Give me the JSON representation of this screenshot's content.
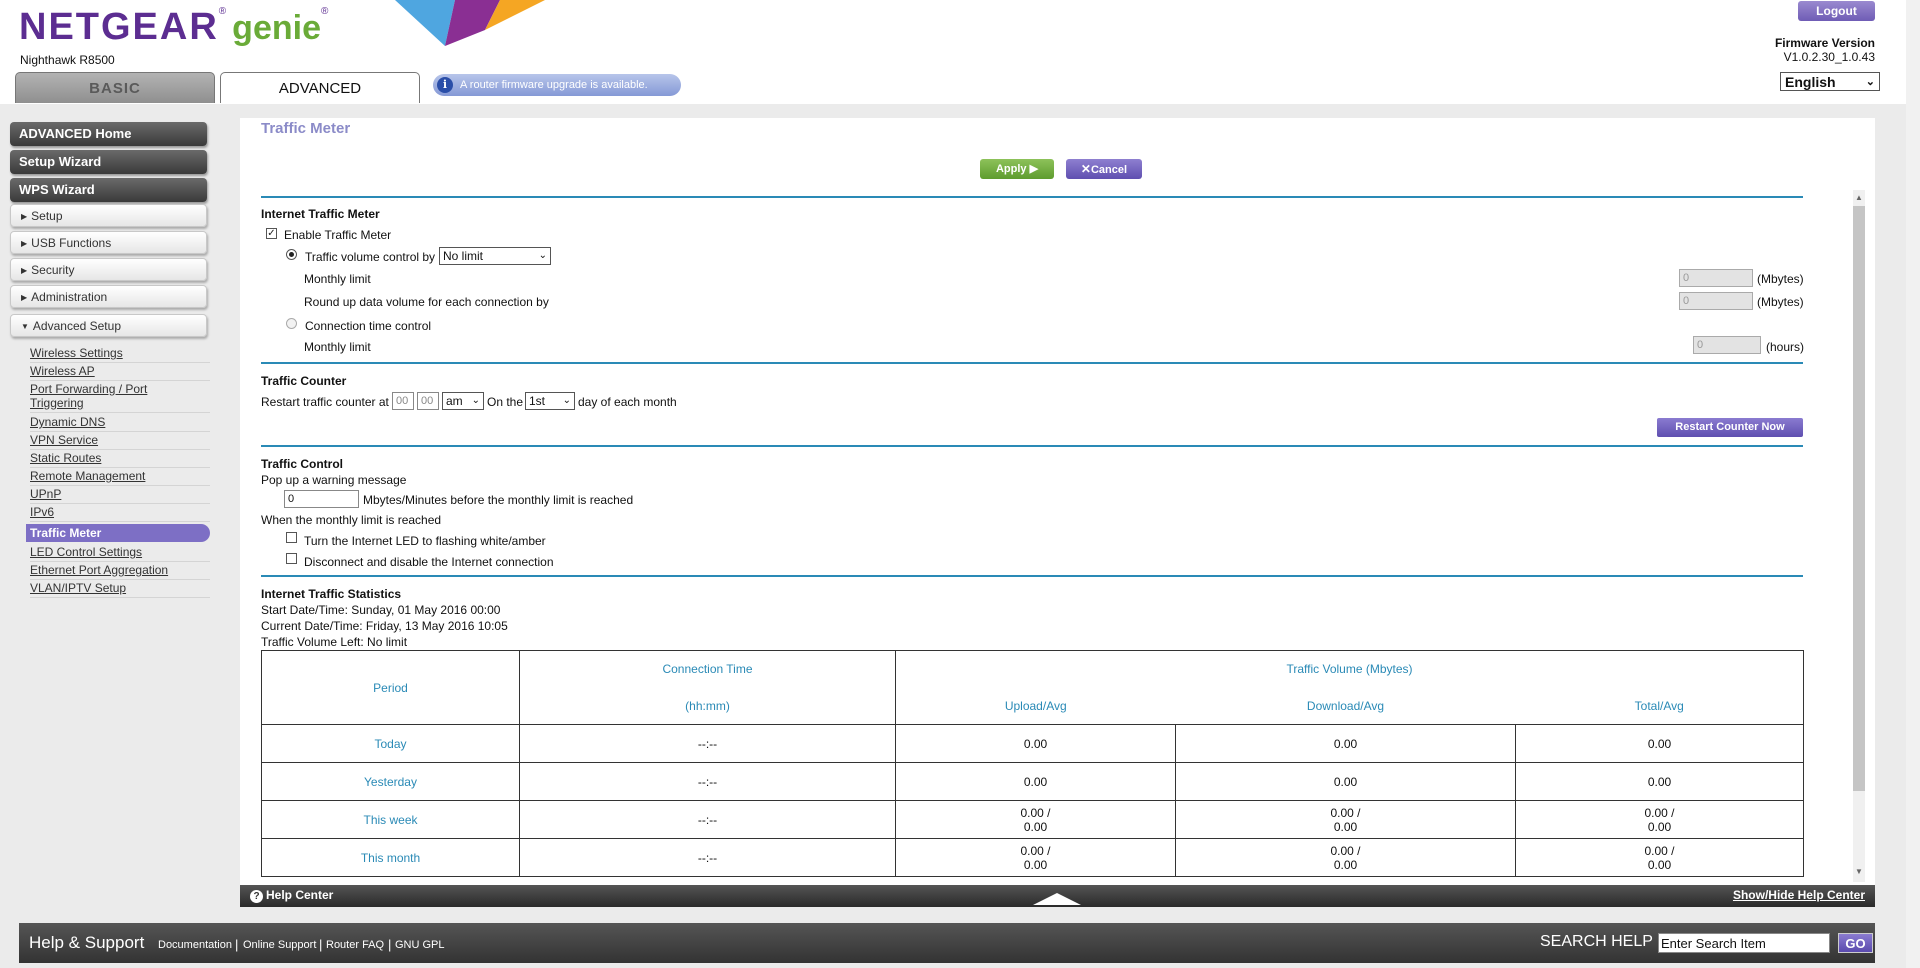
{
  "header": {
    "brand_netgear": "NETGEAR",
    "brand_genie": "genie",
    "brand_reg": "®",
    "model": "Nighthawk R8500",
    "tabs": {
      "basic": "BASIC",
      "advanced": "ADVANCED"
    },
    "firmware_notice": "A router firmware upgrade is available.",
    "logout": "Logout",
    "firmware_label": "Firmware Version",
    "firmware_value": "V1.0.2.30_1.0.43",
    "language": "English"
  },
  "sidebar": {
    "buttons": [
      "ADVANCED Home",
      "Setup Wizard",
      "WPS Wizard"
    ],
    "menus": [
      "Setup",
      "USB Functions",
      "Security",
      "Administration",
      "Advanced Setup"
    ],
    "sub_items": [
      "Wireless Settings",
      "Wireless AP",
      "Port Forwarding / Port",
      "Triggering",
      "Dynamic DNS",
      "VPN Service",
      "Static Routes",
      "Remote Management",
      "UPnP",
      "IPv6",
      "Traffic Meter",
      "LED Control Settings",
      "Ethernet Port Aggregation",
      "VLAN/IPTV Setup"
    ]
  },
  "page": {
    "title": "Traffic Meter",
    "apply": "Apply ▶",
    "cancel": "Cancel",
    "internet_traffic_meter": {
      "title": "Internet Traffic Meter",
      "enable": "Enable Traffic Meter",
      "volume_control": "Traffic volume control by",
      "volume_control_value": "No limit",
      "monthly_limit": "Monthly limit",
      "monthly_limit_value": "0",
      "monthly_limit_unit": "(Mbytes)",
      "round_up": "Round up data volume for each connection by",
      "round_up_value": "0",
      "round_up_unit": "(Mbytes)",
      "time_control": "Connection time control",
      "time_monthly_limit": "Monthly limit",
      "time_monthly_value": "0",
      "time_unit": "(hours)"
    },
    "traffic_counter": {
      "title": "Traffic Counter",
      "restart_at": "Restart traffic counter at",
      "hour": "00",
      "minute": "00",
      "ampm": "am",
      "on_the": "On the",
      "day": "1st",
      "day_suffix": "day of each month",
      "restart_now": "Restart Counter Now"
    },
    "traffic_control": {
      "title": "Traffic Control",
      "popup": "Pop up a warning message",
      "popup_value": "0",
      "popup_suffix": "Mbytes/Minutes before the monthly limit is reached",
      "when_reached": "When the monthly limit is reached",
      "led_flash": "Turn the Internet LED to flashing white/amber",
      "disconnect": "Disconnect and disable the Internet connection"
    },
    "statistics": {
      "title": "Internet Traffic Statistics",
      "start": "Start Date/Time: Sunday, 01 May 2016 00:00",
      "current": "Current Date/Time: Friday, 13 May 2016 10:05",
      "volume_left": "Traffic Volume Left: No limit",
      "headers": {
        "period": "Period",
        "connection_time": "Connection Time",
        "hhmm": "(hh:mm)",
        "traffic_volume": "Traffic Volume (Mbytes)",
        "upload": "Upload/Avg",
        "download": "Download/Avg",
        "total": "Total/Avg"
      },
      "rows": [
        {
          "period": "Today",
          "time": "--:--",
          "upload": "0.00",
          "download": "0.00",
          "total": "0.00"
        },
        {
          "period": "Yesterday",
          "time": "--:--",
          "upload": "0.00",
          "download": "0.00",
          "total": "0.00"
        },
        {
          "period": "This week",
          "time": "--:--",
          "upload": "0.00 /",
          "upload2": "0.00",
          "download": "0.00 /",
          "download2": "0.00",
          "total": "0.00 /",
          "total2": "0.00"
        },
        {
          "period": "This month",
          "time": "--:--",
          "upload": "0.00 /",
          "upload2": "0.00",
          "download": "0.00 /",
          "download2": "0.00",
          "total": "0.00 /",
          "total2": "0.00"
        }
      ]
    }
  },
  "help_bar": {
    "help_center": "Help Center",
    "toggle": "Show/Hide Help Center"
  },
  "footer": {
    "title": "Help & Support",
    "links": [
      "Documentation",
      "Online Support",
      "Router FAQ",
      "GNU GPL"
    ],
    "search_label": "SEARCH HELP",
    "search_value": "Enter Search Item",
    "go": "GO"
  }
}
